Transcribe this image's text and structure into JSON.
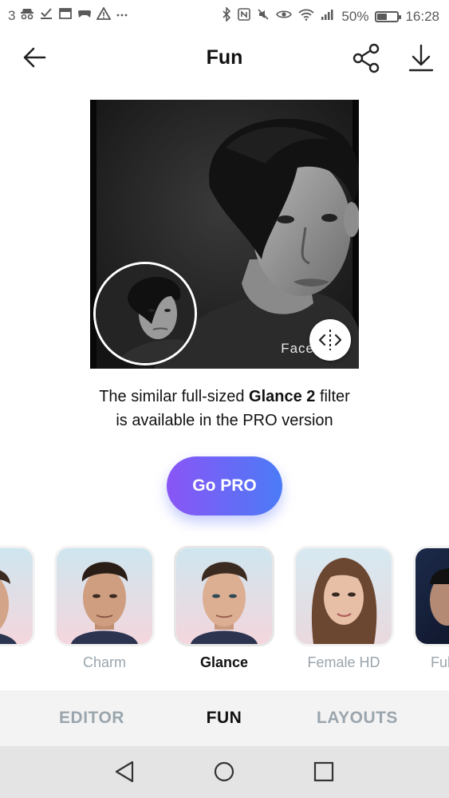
{
  "status_bar": {
    "notification_count": "3",
    "icons_left": [
      "incognito-icon",
      "check-icon",
      "calendar-icon",
      "game-controller-icon",
      "warning-icon",
      "more-dots-icon"
    ],
    "icons_right": [
      "bluetooth-icon",
      "nfc-icon",
      "mute-icon",
      "eye-icon",
      "wifi-icon",
      "signal-icon"
    ],
    "battery_percent": "50%",
    "battery_level": 0.5,
    "time": "16:28"
  },
  "header": {
    "title": "Fun",
    "back_icon": "arrow-left-icon",
    "share_icon": "share-icon",
    "download_icon": "download-icon"
  },
  "photo": {
    "watermark": "Face"
  },
  "message": {
    "line1_prefix": "The similar full-sized ",
    "filter_name": "Glance 2",
    "line1_suffix": " filter",
    "line2": "is available in the PRO version"
  },
  "go_pro": {
    "label": "Go PRO"
  },
  "filters": [
    {
      "label": "",
      "selected": false
    },
    {
      "label": "Charm",
      "selected": false
    },
    {
      "label": "Glance",
      "selected": true
    },
    {
      "label": "Female HD",
      "selected": false
    },
    {
      "label": "Ful",
      "selected": false
    }
  ],
  "tabs": {
    "editor": "EDITOR",
    "fun": "FUN",
    "layouts": "LAYOUTS",
    "active": "FUN"
  },
  "navbar": {
    "back": "nav-back-icon",
    "home": "nav-home-icon",
    "recents": "nav-recents-icon"
  },
  "colors": {
    "go_pro_gradient_start": "#8a55f5",
    "go_pro_gradient_end": "#4b7bf7",
    "inactive_tab": "#9aa5ad",
    "active_tab": "#111111"
  }
}
